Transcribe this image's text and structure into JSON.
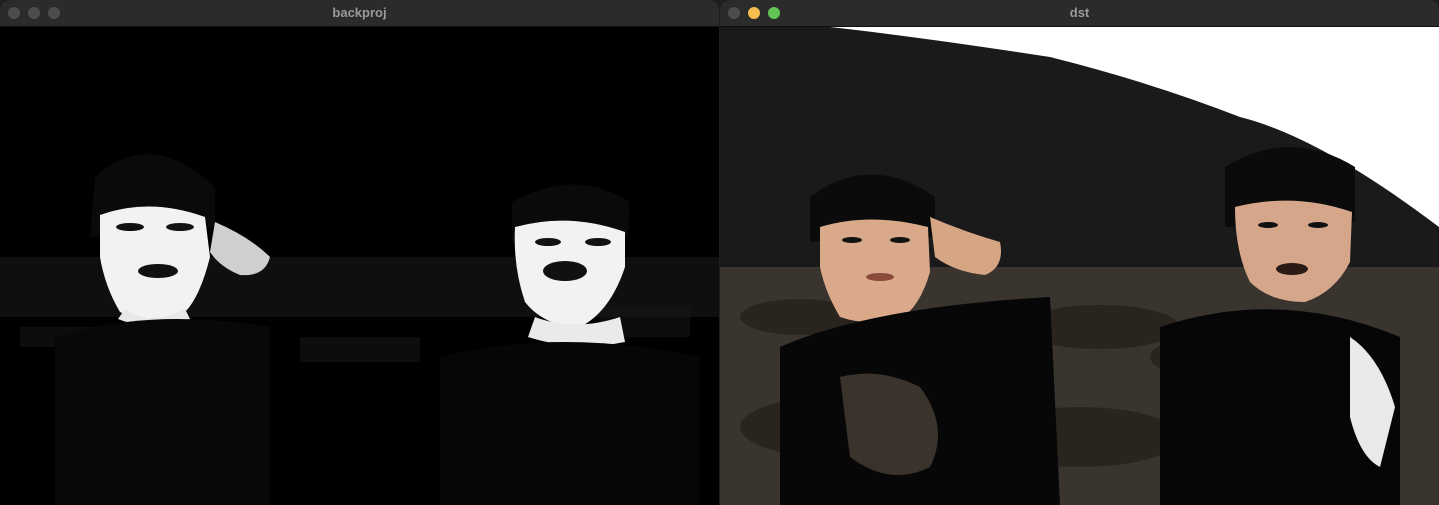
{
  "windows": [
    {
      "title": "backproj"
    },
    {
      "title": "dst"
    }
  ],
  "colors": {
    "titlebar": "#2b2b2b",
    "inactive_button": "#4d4d4d",
    "minimize_button": "#f5bd4f",
    "zoom_button": "#61c454"
  }
}
